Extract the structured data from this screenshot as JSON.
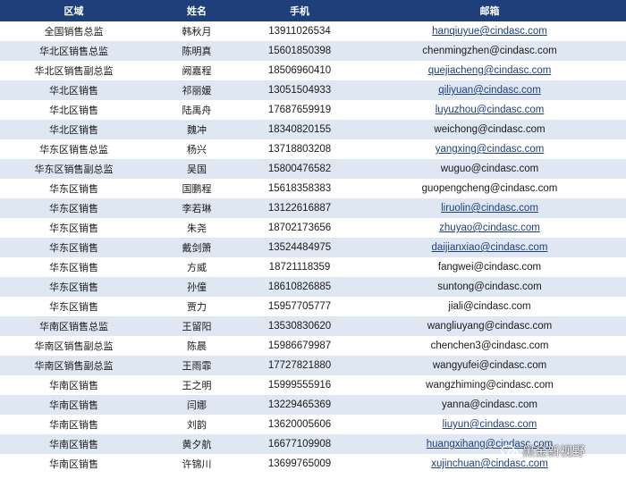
{
  "table": {
    "headers": {
      "region": "区域",
      "name": "姓名",
      "phone": "手机",
      "email": "邮箱"
    },
    "rows": [
      {
        "region": "全国销售总监",
        "name": "韩秋月",
        "phone": "13911026534",
        "email": "hanqiuyue@cindasc.com",
        "link": true
      },
      {
        "region": "华北区销售总监",
        "name": "陈明真",
        "phone": "15601850398",
        "email": "chenmingzhen@cindasc.com",
        "link": false
      },
      {
        "region": "华北区销售副总监",
        "name": "阙嘉程",
        "phone": "18506960410",
        "email": "quejiacheng@cindasc.com",
        "link": true
      },
      {
        "region": "华北区销售",
        "name": "祁丽媛",
        "phone": "13051504933",
        "email": "qiliyuan@cindasc.com",
        "link": true
      },
      {
        "region": "华北区销售",
        "name": "陆禹舟",
        "phone": "17687659919",
        "email": "luyuzhou@cindasc.com",
        "link": true
      },
      {
        "region": "华北区销售",
        "name": "魏冲",
        "phone": "18340820155",
        "email": "weichong@cindasc.com",
        "link": false
      },
      {
        "region": "华东区销售总监",
        "name": "杨兴",
        "phone": "13718803208",
        "email": "yangxing@cindasc.com",
        "link": true
      },
      {
        "region": "华东区销售副总监",
        "name": "吴国",
        "phone": "15800476582",
        "email": "wuguo@cindasc.com",
        "link": false
      },
      {
        "region": "华东区销售",
        "name": "国鹏程",
        "phone": "15618358383",
        "email": "guopengcheng@cindasc.com",
        "link": false
      },
      {
        "region": "华东区销售",
        "name": "李若琳",
        "phone": "13122616887",
        "email": "liruolin@cindasc.com",
        "link": true
      },
      {
        "region": "华东区销售",
        "name": "朱尧",
        "phone": "18702173656",
        "email": "zhuyao@cindasc.com",
        "link": true
      },
      {
        "region": "华东区销售",
        "name": "戴剑箫",
        "phone": "13524484975",
        "email": "daijianxiao@cindasc.com",
        "link": true
      },
      {
        "region": "华东区销售",
        "name": "方威",
        "phone": "18721118359",
        "email": "fangwei@cindasc.com",
        "link": false
      },
      {
        "region": "华东区销售",
        "name": "孙僮",
        "phone": "18610826885",
        "email": "suntong@cindasc.com",
        "link": false
      },
      {
        "region": "华东区销售",
        "name": "贾力",
        "phone": "15957705777",
        "email": "jiali@cindasc.com",
        "link": false
      },
      {
        "region": "华南区销售总监",
        "name": "王留阳",
        "phone": "13530830620",
        "email": "wangliuyang@cindasc.com",
        "link": false
      },
      {
        "region": "华南区销售副总监",
        "name": "陈晨",
        "phone": "15986679987",
        "email": "chenchen3@cindasc.com",
        "link": false
      },
      {
        "region": "华南区销售副总监",
        "name": "王雨霏",
        "phone": "17727821880",
        "email": "wangyufei@cindasc.com",
        "link": false
      },
      {
        "region": "华南区销售",
        "name": "王之明",
        "phone": "15999555916",
        "email": "wangzhiming@cindasc.com",
        "link": false
      },
      {
        "region": "华南区销售",
        "name": "闫娜",
        "phone": "13229465369",
        "email": "yanna@cindasc.com",
        "link": false
      },
      {
        "region": "华南区销售",
        "name": "刘韵",
        "phone": "13620005606",
        "email": "liuyun@cindasc.com",
        "link": true
      },
      {
        "region": "华南区销售",
        "name": "黄夕航",
        "phone": "16677109908",
        "email": "huangxihang@cindasc.com",
        "link": true
      },
      {
        "region": "华南区销售",
        "name": "许锦川",
        "phone": "13699765009",
        "email": "xujinchuan@cindasc.com",
        "link": true
      }
    ]
  },
  "watermark": {
    "text": "黑金新视野",
    "icon": "wechat-icon"
  },
  "colors": {
    "header_bg": "#1f3f7a",
    "stripe_bg": "#dfe7f3",
    "link": "#1f3f7a"
  }
}
